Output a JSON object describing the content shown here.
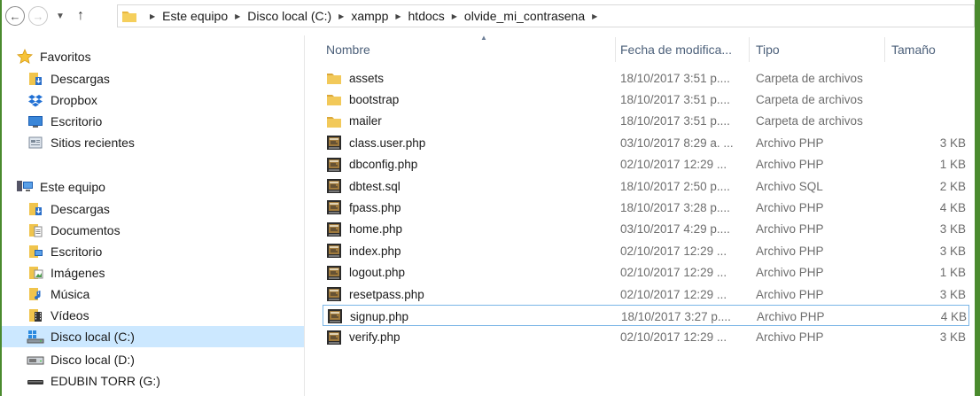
{
  "toolbar": {
    "back_icon": "back-arrow-icon",
    "forward_icon": "forward-arrow-icon",
    "breadcrumbs": [
      "Este equipo",
      "Disco local (C:)",
      "xampp",
      "htdocs",
      "olvide_mi_contrasena"
    ]
  },
  "nav": {
    "favorites_label": "Favoritos",
    "favorites": [
      "Descargas",
      "Dropbox",
      "Escritorio",
      "Sitios recientes"
    ],
    "pc_label": "Este equipo",
    "pc_items": [
      "Descargas",
      "Documentos",
      "Escritorio",
      "Imágenes",
      "Música",
      "Vídeos",
      "Disco local (C:)",
      "Disco local (D:)",
      "EDUBIN TORR (G:)"
    ]
  },
  "columns": {
    "name": "Nombre",
    "date": "Fecha de modifica...",
    "type": "Tipo",
    "size": "Tamaño"
  },
  "files": [
    {
      "name": "assets",
      "date": "18/10/2017 3:51 p....",
      "type": "Carpeta de archivos",
      "size": "",
      "kind": "folder"
    },
    {
      "name": "bootstrap",
      "date": "18/10/2017 3:51 p....",
      "type": "Carpeta de archivos",
      "size": "",
      "kind": "folder"
    },
    {
      "name": "mailer",
      "date": "18/10/2017 3:51 p....",
      "type": "Carpeta de archivos",
      "size": "",
      "kind": "folder"
    },
    {
      "name": "class.user.php",
      "date": "03/10/2017 8:29 a. ...",
      "type": "Archivo PHP",
      "size": "3 KB",
      "kind": "file"
    },
    {
      "name": "dbconfig.php",
      "date": "02/10/2017 12:29 ...",
      "type": "Archivo PHP",
      "size": "1 KB",
      "kind": "file"
    },
    {
      "name": "dbtest.sql",
      "date": "18/10/2017 2:50 p....",
      "type": "Archivo SQL",
      "size": "2 KB",
      "kind": "file"
    },
    {
      "name": "fpass.php",
      "date": "18/10/2017 3:28 p....",
      "type": "Archivo PHP",
      "size": "4 KB",
      "kind": "file"
    },
    {
      "name": "home.php",
      "date": "03/10/2017 4:29 p....",
      "type": "Archivo PHP",
      "size": "3 KB",
      "kind": "file"
    },
    {
      "name": "index.php",
      "date": "02/10/2017 12:29 ...",
      "type": "Archivo PHP",
      "size": "3 KB",
      "kind": "file"
    },
    {
      "name": "logout.php",
      "date": "02/10/2017 12:29 ...",
      "type": "Archivo PHP",
      "size": "1 KB",
      "kind": "file"
    },
    {
      "name": "resetpass.php",
      "date": "02/10/2017 12:29 ...",
      "type": "Archivo PHP",
      "size": "3 KB",
      "kind": "file"
    },
    {
      "name": "signup.php",
      "date": "18/10/2017 3:27 p....",
      "type": "Archivo PHP",
      "size": "4 KB",
      "kind": "file",
      "selected": true
    },
    {
      "name": "verify.php",
      "date": "02/10/2017 12:29 ...",
      "type": "Archivo PHP",
      "size": "3 KB",
      "kind": "file"
    }
  ],
  "colors": {
    "accent_border": "#4a8a2e",
    "selection_bg": "#cce8ff",
    "selection_border": "#7ab5e6",
    "header_text": "#4c607a"
  }
}
